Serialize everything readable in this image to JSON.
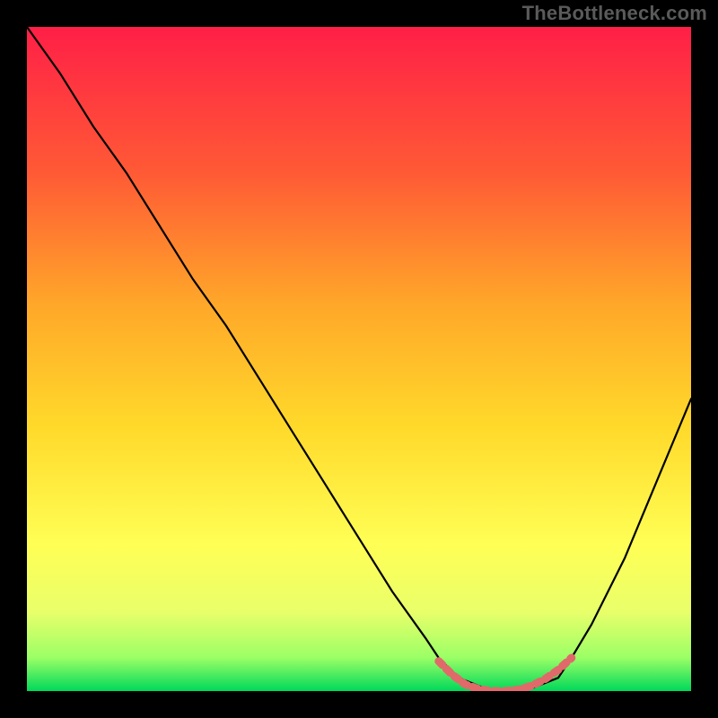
{
  "watermark": "TheBottleneck.com",
  "chart_data": {
    "type": "line",
    "title": "",
    "xlabel": "",
    "ylabel": "",
    "xlim": [
      0,
      100
    ],
    "ylim": [
      0,
      100
    ],
    "grid": false,
    "legend": false,
    "background_gradient_colors": [
      "#ff1f47",
      "#ff7e2a",
      "#ffd22a",
      "#ffff4a",
      "#e6ff66",
      "#5dff5d",
      "#00d85a"
    ],
    "series": [
      {
        "name": "bottleneck-curve",
        "color": "#000000",
        "x": [
          0,
          5,
          10,
          15,
          20,
          25,
          30,
          35,
          40,
          45,
          50,
          55,
          60,
          62,
          65,
          70,
          75,
          80,
          82,
          85,
          90,
          95,
          100
        ],
        "y": [
          100,
          93,
          85,
          78,
          70,
          62,
          55,
          47,
          39,
          31,
          23,
          15,
          8,
          5,
          2,
          0,
          0,
          2,
          5,
          10,
          20,
          32,
          44
        ]
      },
      {
        "name": "optimal-range-marker",
        "color": "#e06a6a",
        "x": [
          62,
          64,
          66,
          68,
          70,
          72,
          74,
          76,
          78,
          80,
          82
        ],
        "y": [
          4.5,
          2.5,
          1,
          0.3,
          0,
          0,
          0.2,
          0.8,
          1.8,
          3.2,
          5
        ]
      }
    ],
    "annotations": []
  }
}
